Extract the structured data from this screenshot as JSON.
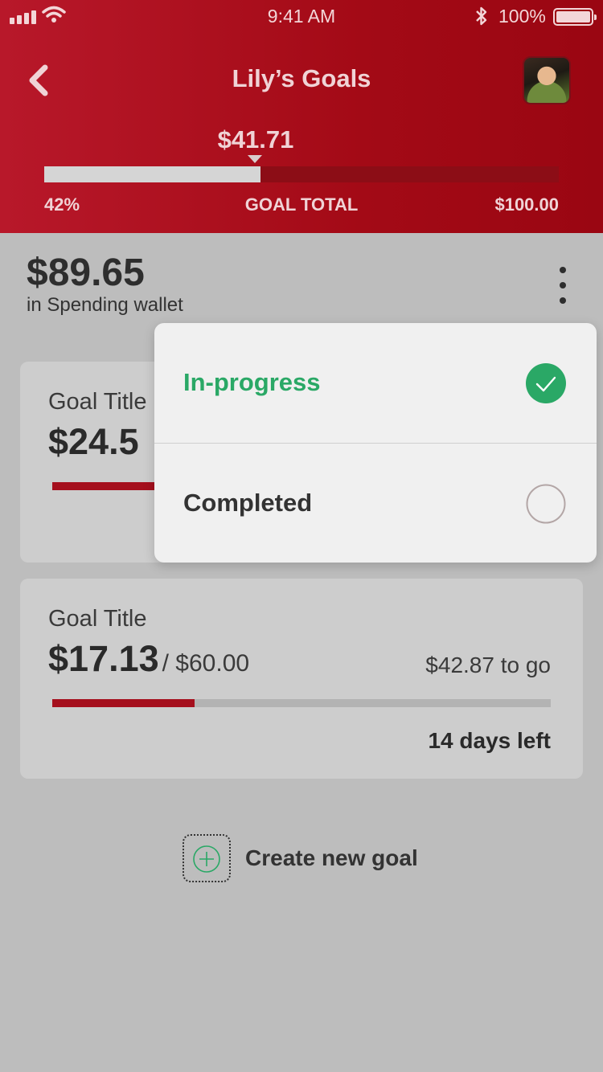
{
  "status_bar": {
    "time": "9:41 AM",
    "battery_pct": "100%"
  },
  "header": {
    "title": "Lily’s Goals",
    "progress_amount": "$41.71",
    "progress_fraction": 0.42,
    "percent_label": "42%",
    "goal_total_label": "GOAL TOTAL",
    "goal_total_value": "$100.00"
  },
  "wallet": {
    "amount": "$89.65",
    "label": "in Spending wallet"
  },
  "goals": [
    {
      "title": "Goal Title",
      "current": "$24.5",
      "progress_fraction": 0.41
    },
    {
      "title": "Goal Title",
      "current": "$17.13",
      "target": "/ $60.00",
      "to_go": "$42.87 to go",
      "progress_fraction": 0.285,
      "days_left": "14 days left"
    }
  ],
  "create_goal": {
    "label": "Create new goal"
  },
  "filter_menu": {
    "items": [
      {
        "label": "In-progress",
        "selected": true
      },
      {
        "label": "Completed",
        "selected": false
      }
    ]
  },
  "colors": {
    "brand_red": "#b8182a",
    "accent_green": "#2aa866",
    "page_bg": "#bdbdbd"
  }
}
